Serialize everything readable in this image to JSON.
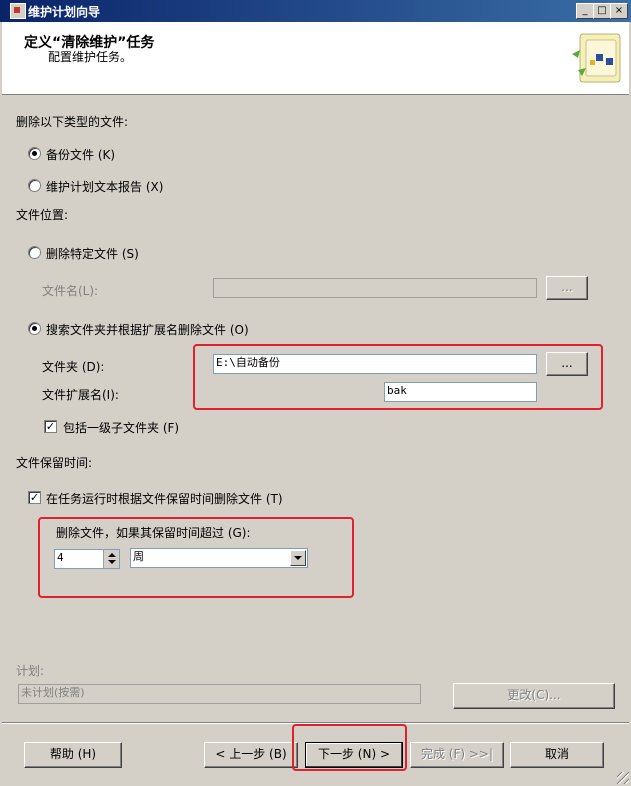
{
  "window": {
    "title": "维护计划向导",
    "controls": [
      "_",
      "□",
      "×"
    ]
  },
  "header": {
    "title": "定义“清除维护”任务",
    "subtitle": "配置维护任务。"
  },
  "file_types": {
    "label": "删除以下类型的文件:",
    "options": [
      {
        "label": "备份文件 (K)",
        "selected": true
      },
      {
        "label": "维护计划文本报告 (X)",
        "selected": false
      }
    ]
  },
  "file_location": {
    "label": "文件位置:",
    "specific_file": {
      "label": "删除特定文件 (S)",
      "selected": false
    },
    "file_name": {
      "label": "文件名(L):",
      "value": "",
      "browse": "..."
    },
    "search_folder": {
      "label": "搜索文件夹并根据扩展名删除文件 (O)",
      "selected": true
    },
    "folder": {
      "label": "文件夹 (D):",
      "value": "E:\\自动备份",
      "browse": "..."
    },
    "extension": {
      "label": "文件扩展名(I):",
      "value": "bak"
    },
    "include_subfolders": {
      "label": "包括一级子文件夹 (F)",
      "checked": true
    }
  },
  "retention": {
    "label": "文件保留时间:",
    "delete_by_age": {
      "label": "在任务运行时根据文件保留时间删除文件 (T)",
      "checked": true
    },
    "older_than_label": "删除文件，如果其保留时间超过 (G):",
    "amount": "4",
    "unit": "周"
  },
  "schedule": {
    "label": "计划:",
    "value": "未计划(按需)",
    "change_button": "更改(C)..."
  },
  "footer": {
    "help": "帮助 (H)",
    "back": "< 上一步 (B)",
    "next": "下一步 (N) >",
    "finish": "完成 (F) >>|",
    "cancel": "取消"
  },
  "colors": {
    "highlight_box": "#e0202a",
    "title_bar": "#0a246a"
  }
}
